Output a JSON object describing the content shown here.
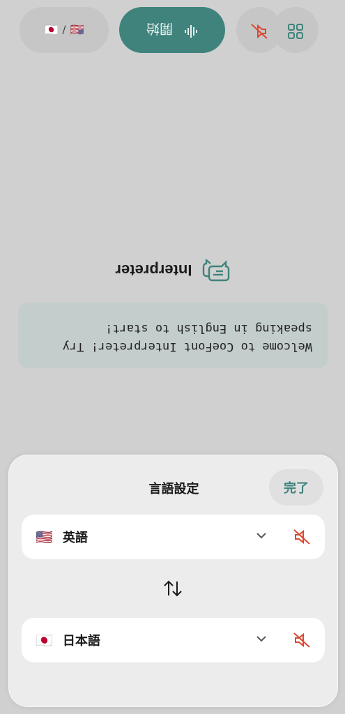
{
  "banner": {
    "text_line1": "Welcome to CoeFont Interpreter! Try",
    "text_line2": "speaking in English to start!"
  },
  "header": {
    "title": "Interpreter",
    "icon": "chat-bubbles-icon"
  },
  "controls": {
    "language_pair": {
      "from_flag": "🇺🇸",
      "separator": "/",
      "to_flag": "🇯🇵"
    },
    "start_label": "開始",
    "mute_icon": "speaker-mute-icon",
    "grid_icon": "grid-icon"
  },
  "sheet": {
    "title": "言語設定",
    "done_label": "完了",
    "source": {
      "flag": "🇺🇸",
      "name": "英語"
    },
    "target": {
      "flag": "🇯🇵",
      "name": "日本語"
    },
    "swap_icon": "swap-arrows-icon"
  },
  "colors": {
    "accent": "#3f837c",
    "mute_red": "#d9482f"
  }
}
